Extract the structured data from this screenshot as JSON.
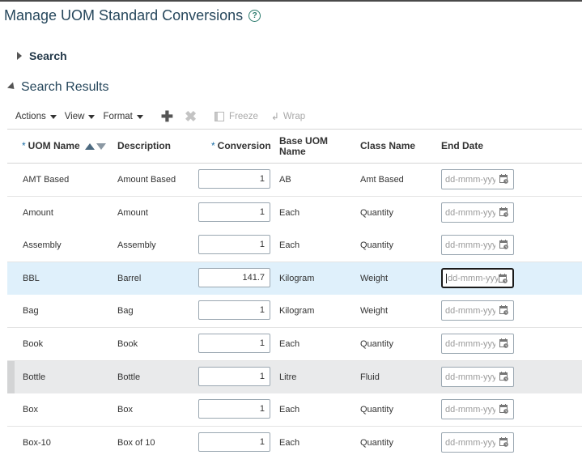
{
  "page": {
    "title": "Manage UOM Standard Conversions",
    "help_glyph": "?"
  },
  "search": {
    "label": "Search"
  },
  "results": {
    "label": "Search Results"
  },
  "toolbar": {
    "actions_label": "Actions",
    "view_label": "View",
    "format_label": "Format",
    "add_glyph": "✚",
    "delete_glyph": "✖",
    "freeze_label": "Freeze",
    "wrap_label": "Wrap"
  },
  "table": {
    "required_mark": "*",
    "columns": {
      "uom_name": "UOM Name",
      "description": "Description",
      "conversion": "Conversion",
      "base_uom": "Base UOM Name",
      "class_name": "Class Name",
      "end_date": "End Date"
    },
    "date_placeholder": "dd-mmm-yyyy",
    "rows": [
      {
        "uom_name": "AMT Based",
        "description": "Amount Based",
        "conversion": "1",
        "base_uom": "AB",
        "class_name": "Amt Based"
      },
      {
        "uom_name": "Amount",
        "description": "Amount",
        "conversion": "1",
        "base_uom": "Each",
        "class_name": "Quantity"
      },
      {
        "uom_name": "Assembly",
        "description": "Assembly",
        "conversion": "1",
        "base_uom": "Each",
        "class_name": "Quantity"
      },
      {
        "uom_name": "BBL",
        "description": "Barrel",
        "conversion": "141.7",
        "base_uom": "Kilogram",
        "class_name": "Weight"
      },
      {
        "uom_name": "Bag",
        "description": "Bag",
        "conversion": "1",
        "base_uom": "Kilogram",
        "class_name": "Weight"
      },
      {
        "uom_name": "Book",
        "description": "Book",
        "conversion": "1",
        "base_uom": "Each",
        "class_name": "Quantity"
      },
      {
        "uom_name": "Bottle",
        "description": "Bottle",
        "conversion": "1",
        "base_uom": "Litre",
        "class_name": "Fluid"
      },
      {
        "uom_name": "Box",
        "description": "Box",
        "conversion": "1",
        "base_uom": "Each",
        "class_name": "Quantity"
      },
      {
        "uom_name": "Box-10",
        "description": "Box of 10",
        "conversion": "1",
        "base_uom": "Each",
        "class_name": "Quantity"
      }
    ]
  },
  "colors": {
    "title": "#26475c",
    "selected_row": "#dff0fb",
    "hover_row": "#e9eaeb",
    "required": "#1b6ea6"
  }
}
